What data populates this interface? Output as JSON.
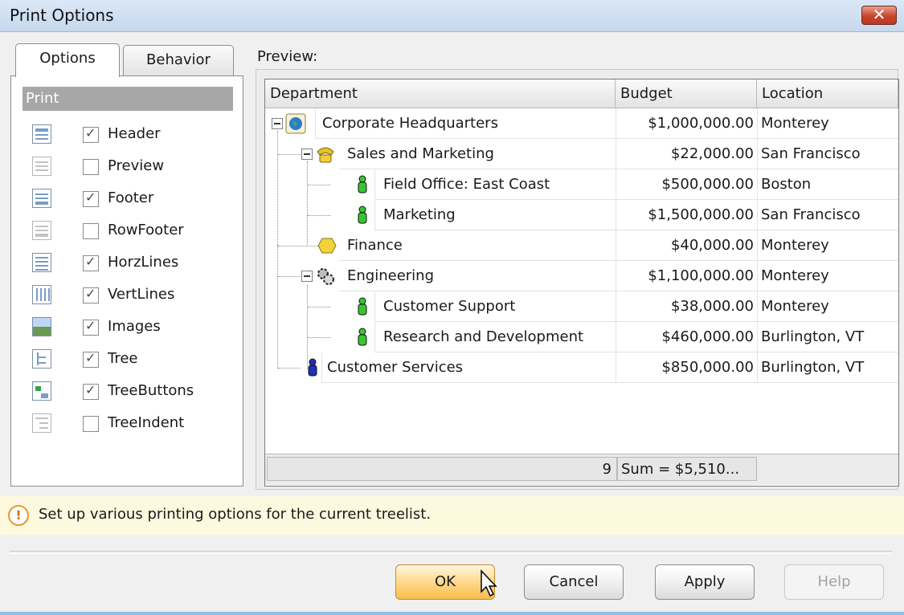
{
  "window": {
    "title": "Print Options"
  },
  "tabs": [
    {
      "label": "Options",
      "active": true
    },
    {
      "label": "Behavior",
      "active": false
    }
  ],
  "print_group": {
    "header": "Print",
    "options": [
      {
        "label": "Header",
        "checked": true
      },
      {
        "label": "Preview",
        "checked": false
      },
      {
        "label": "Footer",
        "checked": true
      },
      {
        "label": "RowFooter",
        "checked": false
      },
      {
        "label": "HorzLines",
        "checked": true
      },
      {
        "label": "VertLines",
        "checked": true
      },
      {
        "label": "Images",
        "checked": true
      },
      {
        "label": "Tree",
        "checked": true
      },
      {
        "label": "TreeButtons",
        "checked": true
      },
      {
        "label": "TreeIndent",
        "checked": false
      }
    ]
  },
  "preview": {
    "label": "Preview:",
    "columns": [
      "Department",
      "Budget",
      "Location"
    ],
    "rows": [
      {
        "department": "Corporate Headquarters",
        "budget": "$1,000,000.00",
        "location": "Monterey",
        "icon": "globe-icon"
      },
      {
        "department": "Sales and Marketing",
        "budget": "$22,000.00",
        "location": "San Francisco",
        "icon": "phone-icon"
      },
      {
        "department": "Field Office: East Coast",
        "budget": "$500,000.00",
        "location": "Boston",
        "icon": "person-green-icon"
      },
      {
        "department": "Marketing",
        "budget": "$1,500,000.00",
        "location": "San Francisco",
        "icon": "person-green-icon"
      },
      {
        "department": "Finance",
        "budget": "$40,000.00",
        "location": "Monterey",
        "icon": "coin-icon"
      },
      {
        "department": "Engineering",
        "budget": "$1,100,000.00",
        "location": "Monterey",
        "icon": "gear-icon"
      },
      {
        "department": "Customer Support",
        "budget": "$38,000.00",
        "location": "Monterey",
        "icon": "person-green-icon"
      },
      {
        "department": "Research and Development",
        "budget": "$460,000.00",
        "location": "Burlington, VT",
        "icon": "person-green-icon"
      },
      {
        "department": "Customer Services",
        "budget": "$850,000.00",
        "location": "Burlington, VT",
        "icon": "person-blue-icon"
      }
    ],
    "footer": {
      "count": "9",
      "sum": "Sum = $5,510..."
    }
  },
  "hint": {
    "text": "Set up various printing options for the current treelist."
  },
  "buttons": {
    "ok": "OK",
    "cancel": "Cancel",
    "apply": "Apply",
    "help": "Help"
  },
  "colors": {
    "title_bar": "#c6d8ee",
    "hint_bg": "#fdf9df",
    "close_red": "#c8452c",
    "ok_orange": "#f6bd4d",
    "person_green": "#37c531",
    "person_blue": "#1e2fb8"
  }
}
